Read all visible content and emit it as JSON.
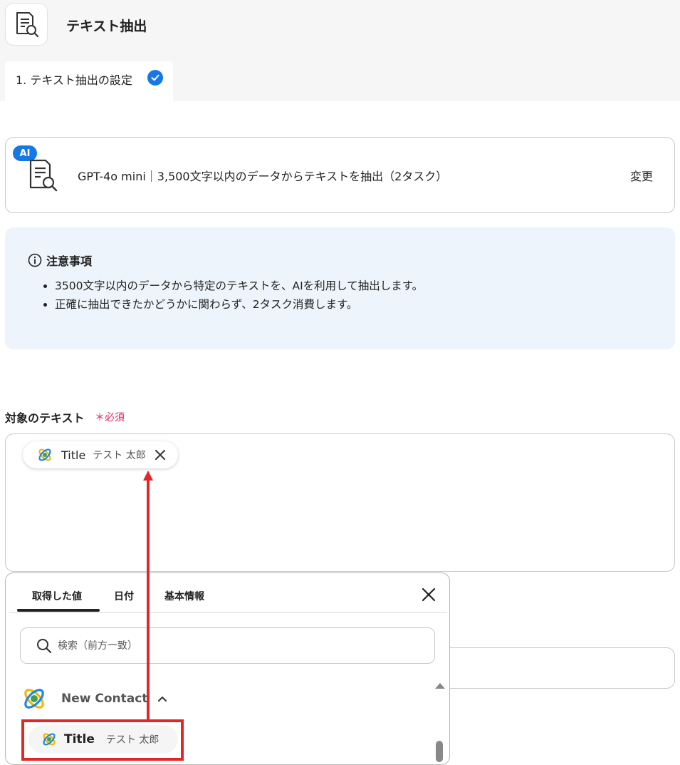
{
  "header": {
    "title": "テキスト抽出",
    "step_tab": "1. テキスト抽出の設定"
  },
  "ai_card": {
    "badge": "AI",
    "model_text": "GPT-4o mini｜3,500文字以内のデータからテキストを抽出（2タスク）",
    "change_label": "変更"
  },
  "notice": {
    "title": "注意事項",
    "items": [
      "3500文字以内のデータから特定のテキストを、AIを利用して抽出します。",
      "正確に抽出できたかどうかに関わらず、2タスク消費します。"
    ]
  },
  "target_field": {
    "label": "対象のテキスト",
    "required": "＊必須",
    "chip": {
      "title": "Title",
      "value": "テスト 太郎"
    }
  },
  "popup": {
    "tabs": [
      "取得した値",
      "日付",
      "基本情報"
    ],
    "active_tab": "取得した値",
    "search_placeholder": "検索（前方一致）",
    "group": {
      "label": "New Contact"
    },
    "item": {
      "title": "Title",
      "value": "テスト 太郎"
    }
  },
  "colors": {
    "accent": "#1677e5",
    "required": "#e0245e",
    "highlight": "#e02828",
    "notice_bg": "#eef4fb"
  },
  "icons": [
    "document-search-icon",
    "check-icon",
    "info-icon",
    "close-icon",
    "search-icon",
    "orbit-logo-icon",
    "chevron-up-icon"
  ]
}
